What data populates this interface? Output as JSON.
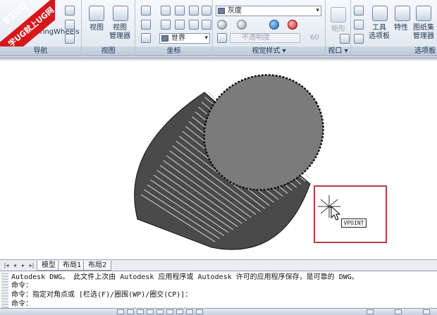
{
  "watermark": {
    "line1": "9SUG",
    "line2": "学UG就上UG网"
  },
  "ribbon": {
    "nav_panel": {
      "title": "导航",
      "steering_label": "SteeringWheels"
    },
    "view_panel": {
      "title": "视图",
      "view_label": "视图",
      "view_manager_label": "视图\n管理器"
    },
    "coords_panel": {
      "title": "坐标",
      "ucs_value": "世界"
    },
    "visual_panel": {
      "title": "视觉样式 ▾",
      "style_value": "灰度",
      "opacity_placeholder": "不透明度",
      "opacity_value": "60"
    },
    "viewport_panel": {
      "title": "视口 ▾",
      "item_label": "矩形"
    },
    "palettes_panel": {
      "title": "选项板",
      "tool_palette_label": "工具\n选项板",
      "properties_label": "特性",
      "sheet_set_label": "图纸集\n管理器"
    }
  },
  "drawing": {
    "tooltip": "VPOINT"
  },
  "tabs": [
    {
      "label": "模型",
      "active": true
    },
    {
      "label": "布局1",
      "active": false
    },
    {
      "label": "布局2",
      "active": false
    }
  ],
  "command": {
    "lines": [
      "Autodesk DWG。  此文件上次由 Autodesk 应用程序或 Autodesk 许可的应用程序保存，是可靠的 DWG。",
      "命令：",
      "命令：指定对角点或 [栏选(F)/圈围(WP)/圈交(CP)]：",
      "命令："
    ]
  },
  "colors": {
    "callout_border": "#b5403c",
    "watermark_red": "#d8161b",
    "ribbon_bg": "#dfe6ef"
  }
}
